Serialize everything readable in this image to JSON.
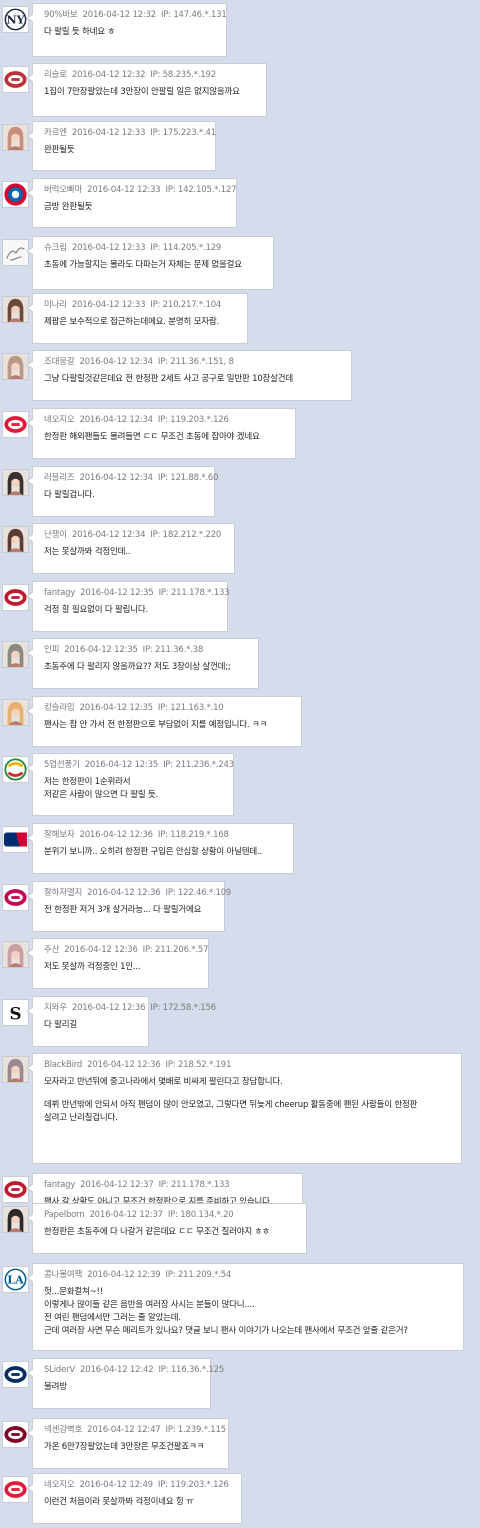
{
  "comments": [
    {
      "nick": "90%바보",
      "time": "2016-04-12 12:32",
      "ip": "IP: 147.46.*.131",
      "lines": [
        "다 팔릴 듯 하네요 ㅎ"
      ],
      "avatar": "yankees-logo-icon",
      "color": "#1c2841"
    },
    {
      "nick": "리슬로",
      "time": "2016-04-12 12:32",
      "ip": "IP: 58.235.*.192",
      "lines": [
        "1집이 7만장팔았는데 3만장이 안팔릴 일은 없지않을까요"
      ],
      "avatar": "red-sox-logo-icon",
      "color": "#bd3039"
    },
    {
      "nick": "카르엔",
      "time": "2016-04-12 12:33",
      "ip": "IP: 175.223.*.41",
      "lines": [
        "완판될듯"
      ],
      "avatar": "profile-photo-icon",
      "color": "#c98f7e"
    },
    {
      "nick": "버럭오빠마",
      "time": "2016-04-12 12:33",
      "ip": "IP: 142.105.*.127",
      "lines": [
        "금방 완판될듯"
      ],
      "avatar": "bayern-munich-logo-icon",
      "color": "#dc052d"
    },
    {
      "nick": "슈크림",
      "time": "2016-04-12 12:33",
      "ip": "IP: 114.205.*.129",
      "lines": [
        "초동에 가능할지는 몰라도 다파는거 자체는 문제 없을걸요"
      ],
      "avatar": "sketch-drawing-icon",
      "color": "#888888"
    },
    {
      "nick": "미나리",
      "time": "2016-04-12 12:33",
      "ip": "IP: 210.217.*.104",
      "lines": [
        "제팝은 보수적으로 접근하는데에요. 분명히 모자람."
      ],
      "avatar": "profile-photo-icon",
      "color": "#6b4a3a"
    },
    {
      "nick": "조대웅갈",
      "time": "2016-04-12 12:34",
      "ip": "IP: 211.36.*.151, 8",
      "lines": [
        "그냥 다팔릴것같은데요 전 한정판 2세트 사고 공구로 일반판 10장살건데"
      ],
      "avatar": "profile-photo-icon",
      "color": "#b89a8a"
    },
    {
      "nick": "네오지오",
      "time": "2016-04-12 12:34",
      "ip": "IP: 119.203.*.126",
      "lines": [
        "한정판 해외팬들도 몰려들면 ㄷㄷ 무조건 초동에 잡아야 겠네요"
      ],
      "avatar": "indians-logo-icon",
      "color": "#e31937"
    },
    {
      "nick": "러블리즈",
      "time": "2016-04-12 12:34",
      "ip": "IP: 121.88.*.60",
      "lines": [
        "다 팔릴겁니다."
      ],
      "avatar": "profile-photo-icon",
      "color": "#3a3030"
    },
    {
      "nick": "난쟁이",
      "time": "2016-04-12 12:34",
      "ip": "IP: 182.212.*.220",
      "lines": [
        "저는 못살까봐 걱정인데.."
      ],
      "avatar": "profile-photo-icon",
      "color": "#5a3c32"
    },
    {
      "nick": "fantagy",
      "time": "2016-04-12 12:35",
      "ip": "IP: 211.178.*.133",
      "lines": [
        "걱정 할 필요없이 다 팔립니다."
      ],
      "avatar": "giants-logo-icon",
      "color": "#bb1a2f"
    },
    {
      "nick": "인피",
      "time": "2016-04-12 12:35",
      "ip": "IP: 211.36.*.38",
      "lines": [
        "초동주에 다 팔리지 않을까요?? 저도 3장이상 살껀데;;"
      ],
      "avatar": "profile-photo-icon",
      "color": "#8a8a80"
    },
    {
      "nick": "킹슬라임",
      "time": "2016-04-12 12:35",
      "ip": "IP: 121.163.*.10",
      "lines": [
        "팬사는 참 안 가서 전 한정판으로 부담없이 지를 예정입니다. ㅋㅋ"
      ],
      "avatar": "profile-photo-icon",
      "color": "#e8b070"
    },
    {
      "nick": "5업선풍기",
      "time": "2016-04-12 12:35",
      "ip": "IP: 211.236.*.243",
      "lines": [
        "저는 한정판이 1순위라서",
        "저같은 사람이 많으면 다 팔릴 듯."
      ],
      "avatar": "wbc-logo-icon",
      "color": "#2a8a3a"
    },
    {
      "nick": "잘해보자",
      "time": "2016-04-12 12:36",
      "ip": "IP: 118.219.*.168",
      "lines": [
        "분위기 보니까.. 오히려 한정판 구입은 안심할 상황이 아닐텐데.."
      ],
      "avatar": "mlb-logo-icon",
      "color": "#002d72"
    },
    {
      "nick": "잘하자엘지",
      "time": "2016-04-12 12:36",
      "ip": "IP: 122.46.*.109",
      "lines": [
        "전 한정판 저거 3개 살거라능... 다 팔릴거에요"
      ],
      "avatar": "twins-logo-icon",
      "color": "#c30452"
    },
    {
      "nick": "주산",
      "time": "2016-04-12 12:36",
      "ip": "IP: 211.206.*.57",
      "lines": [
        "저도 못살까 걱정중인 1인..."
      ],
      "avatar": "profile-photo-icon",
      "color": "#c9a0a8"
    },
    {
      "nick": "지와우",
      "time": "2016-04-12 12:36",
      "ip": "IP: 172.58.*.156",
      "lines": [
        "다 팔리길"
      ],
      "avatar": "white-sox-logo-icon",
      "color": "#111111"
    },
    {
      "nick": "BlackBird",
      "time": "2016-04-12 12:36",
      "ip": "IP: 218.52.*.191",
      "lines": [
        "모자라고 반년뒤에 중고나라에서 몇배로 비싸게 팔린다고 장담합니다.",
        "",
        "데뷔 반년밖에 안되서 아직 팬덤이 많이 안모였고, 그렇다면 뒤늦게 cheerup 활동중에 팬된 사람들이 한정판",
        "살려고 난리칠겁니다."
      ],
      "avatar": "profile-photo-icon",
      "color": "#9a8a90"
    },
    {
      "nick": "fantagy",
      "time": "2016-04-12 12:37",
      "ip": "IP: 211.178.*.133",
      "lines": [
        "팬사 갈 상황도 아니고 무조건 한정판으로 지를 준비하고 있습니다."
      ],
      "avatar": "giants-logo-icon",
      "color": "#bb1a2f"
    },
    {
      "nick": "Papelborn",
      "time": "2016-04-12 12:37",
      "ip": "IP: 180.134.*.20",
      "lines": [
        "한정판은 초동주에 다 나갈거 같은데요 ㄷㄷ 무조건 질러야지 ㅎㅎ"
      ],
      "avatar": "profile-photo-icon",
      "color": "#2a2a2a"
    },
    {
      "nick": "콩나물여팩",
      "time": "2016-04-12 12:39",
      "ip": "IP: 211.209.*.54",
      "lines": [
        "헛...문화컬쳐~!!",
        "이렇게나 많이들 같은 음반을 여러장 사시는 분들이 많다니....",
        "전 여린 팬덤에서만 그러는 줄 알았는데.",
        "근데 여러장 사면 무슨 메리트가 있나요? 댓글 보니 팬사 이야기가 나오는데 팬사에서 무조건 앞줄 같은거?"
      ],
      "avatar": "dodgers-logo-icon",
      "color": "#005a9c"
    },
    {
      "nick": "SLiderV",
      "time": "2016-04-12 12:42",
      "ip": "IP: 116.36.*.125",
      "lines": [
        "불려방"
      ],
      "avatar": "astros-logo-icon",
      "color": "#002d62"
    },
    {
      "nick": "넥센강벽호",
      "time": "2016-04-12 12:47",
      "ip": "IP: 1.239.*.115",
      "lines": [
        "가온 6만7장팔았는데 3만장은 무조건팔죠ㅋㅋ"
      ],
      "avatar": "heroes-logo-icon",
      "color": "#820024"
    },
    {
      "nick": "네오지오",
      "time": "2016-04-12 12:49",
      "ip": "IP: 119.203.*.126",
      "lines": [
        "이런건 처음이라 못살까봐 걱정이네요 힝 ㅠ"
      ],
      "avatar": "indians-logo-icon",
      "color": "#e31937"
    }
  ]
}
